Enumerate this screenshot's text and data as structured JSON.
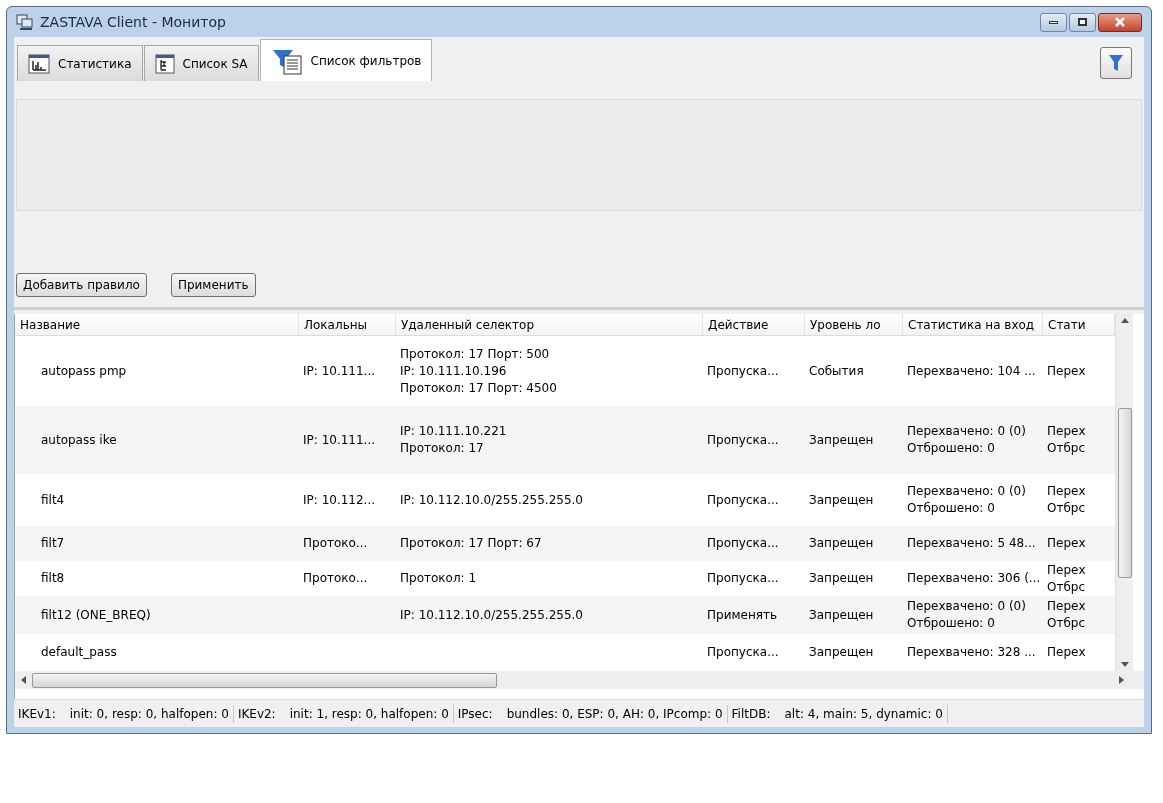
{
  "window": {
    "title": "ZASTAVA Client - Монитор"
  },
  "tabs": [
    {
      "label": "Статистика",
      "selected": false,
      "kind": "chart"
    },
    {
      "label": "Список SA",
      "selected": false,
      "kind": "tree"
    },
    {
      "label": "Список фильтров",
      "selected": true,
      "kind": "filter"
    }
  ],
  "buttons": [
    "Добавить правило",
    "Применить"
  ],
  "table": {
    "columns": [
      "Название",
      "Локальны",
      "Удаленный селектор",
      "Действие",
      "Уровень ло",
      "Статистика на вход",
      "Стати"
    ],
    "rows": [
      {
        "cells": [
          [
            "autopass pmp"
          ],
          [
            "IP: 10.111..."
          ],
          [
            "Протокол: 17 Порт: 500",
            "IP: 10.111.10.196",
            "Протокол: 17 Порт: 4500"
          ],
          [
            "Пропуска..."
          ],
          [
            "События"
          ],
          [
            "Перехвачено: 104 ..."
          ],
          [
            "Перех"
          ]
        ]
      },
      {
        "cells": [
          [
            "autopass ike"
          ],
          [
            "IP: 10.111..."
          ],
          [
            "IP: 10.111.10.221",
            "Протокол: 17"
          ],
          [
            "Пропуска..."
          ],
          [
            "Запрещен"
          ],
          [
            "Перехвачено: 0 (0)",
            "Отброшено: 0"
          ],
          [
            "Перех",
            "Отбрс"
          ]
        ]
      },
      {
        "cells": [
          [
            "filt4"
          ],
          [
            "IP: 10.112..."
          ],
          [
            "IP: 10.112.10.0/255.255.255.0"
          ],
          [
            "Пропуска..."
          ],
          [
            "Запрещен"
          ],
          [
            "Перехвачено: 0 (0)",
            "Отброшено: 0"
          ],
          [
            "Перех",
            "Отбрс"
          ]
        ]
      },
      {
        "cells": [
          [
            "filt7"
          ],
          [
            "Протоко..."
          ],
          [
            "Протокол: 17 Порт: 67"
          ],
          [
            "Пропуска..."
          ],
          [
            "Запрещен"
          ],
          [
            "Перехвачено: 5 48..."
          ],
          [
            "Перех"
          ]
        ]
      },
      {
        "cells": [
          [
            "filt8"
          ],
          [
            "Протоко..."
          ],
          [
            "Протокол: 1"
          ],
          [
            "Пропуска..."
          ],
          [
            "Запрещен"
          ],
          [
            "Перехвачено: 306 (..."
          ],
          [
            "Перех",
            "Отбрс"
          ]
        ]
      },
      {
        "cells": [
          [
            "filt12 (ONE_BREQ)"
          ],
          [],
          [
            "IP: 10.112.10.0/255.255.255.0"
          ],
          [
            "Применять"
          ],
          [
            "Запрещен"
          ],
          [
            "Перехвачено: 0 (0)",
            "Отброшено: 0"
          ],
          [
            "Перех",
            "Отбрс"
          ]
        ]
      },
      {
        "cells": [
          [
            "default_pass"
          ],
          [],
          [],
          [
            "Пропуска..."
          ],
          [
            "Запрещен"
          ],
          [
            "Перехвачено: 328 ..."
          ],
          [
            "Перех"
          ]
        ]
      }
    ]
  },
  "status_bar": [
    {
      "label": "IKEv1:",
      "value": "init: 0, resp: 0, halfopen: 0"
    },
    {
      "label": "IKEv2:",
      "value": "init: 1, resp: 0, halfopen: 0"
    },
    {
      "label": "IPsec:",
      "value": "bundles: 0, ESP: 0, AH: 0, IPcomp: 0"
    },
    {
      "label": "FiltDB:",
      "value": "alt: 4, main: 5, dynamic: 0"
    }
  ]
}
